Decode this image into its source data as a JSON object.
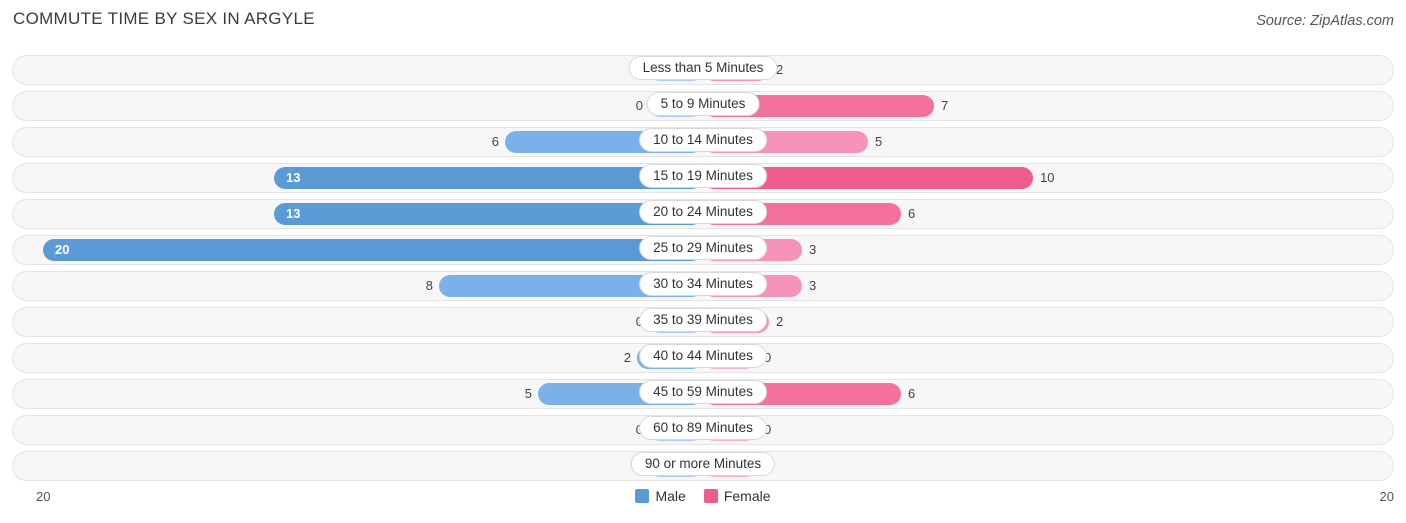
{
  "header": {
    "title": "COMMUTE TIME BY SEX IN ARGYLE",
    "source": "Source: ZipAtlas.com"
  },
  "axis": {
    "left_label": "20",
    "right_label": "20"
  },
  "legend": {
    "items": [
      {
        "label": "Male",
        "color": "#5b9bd5"
      },
      {
        "label": "Female",
        "color": "#f15c8f"
      }
    ]
  },
  "chart_data": {
    "type": "bar",
    "orientation": "horizontal-diverging",
    "title": "COMMUTE TIME BY SEX IN ARGYLE",
    "xlabel": "",
    "ylabel": "",
    "axis_max": 20,
    "grid": false,
    "legend_position": "bottom",
    "categories": [
      "Less than 5 Minutes",
      "5 to 9 Minutes",
      "10 to 14 Minutes",
      "15 to 19 Minutes",
      "20 to 24 Minutes",
      "25 to 29 Minutes",
      "30 to 34 Minutes",
      "35 to 39 Minutes",
      "40 to 44 Minutes",
      "45 to 59 Minutes",
      "60 to 89 Minutes",
      "90 or more Minutes"
    ],
    "series": [
      {
        "name": "Male",
        "color": "#7cb0e8",
        "values": [
          0,
          0,
          6,
          13,
          13,
          20,
          8,
          0,
          2,
          5,
          0,
          0
        ]
      },
      {
        "name": "Female",
        "color": "#f793b9",
        "values": [
          2,
          7,
          5,
          10,
          6,
          3,
          3,
          2,
          0,
          6,
          0,
          0
        ]
      }
    ]
  }
}
